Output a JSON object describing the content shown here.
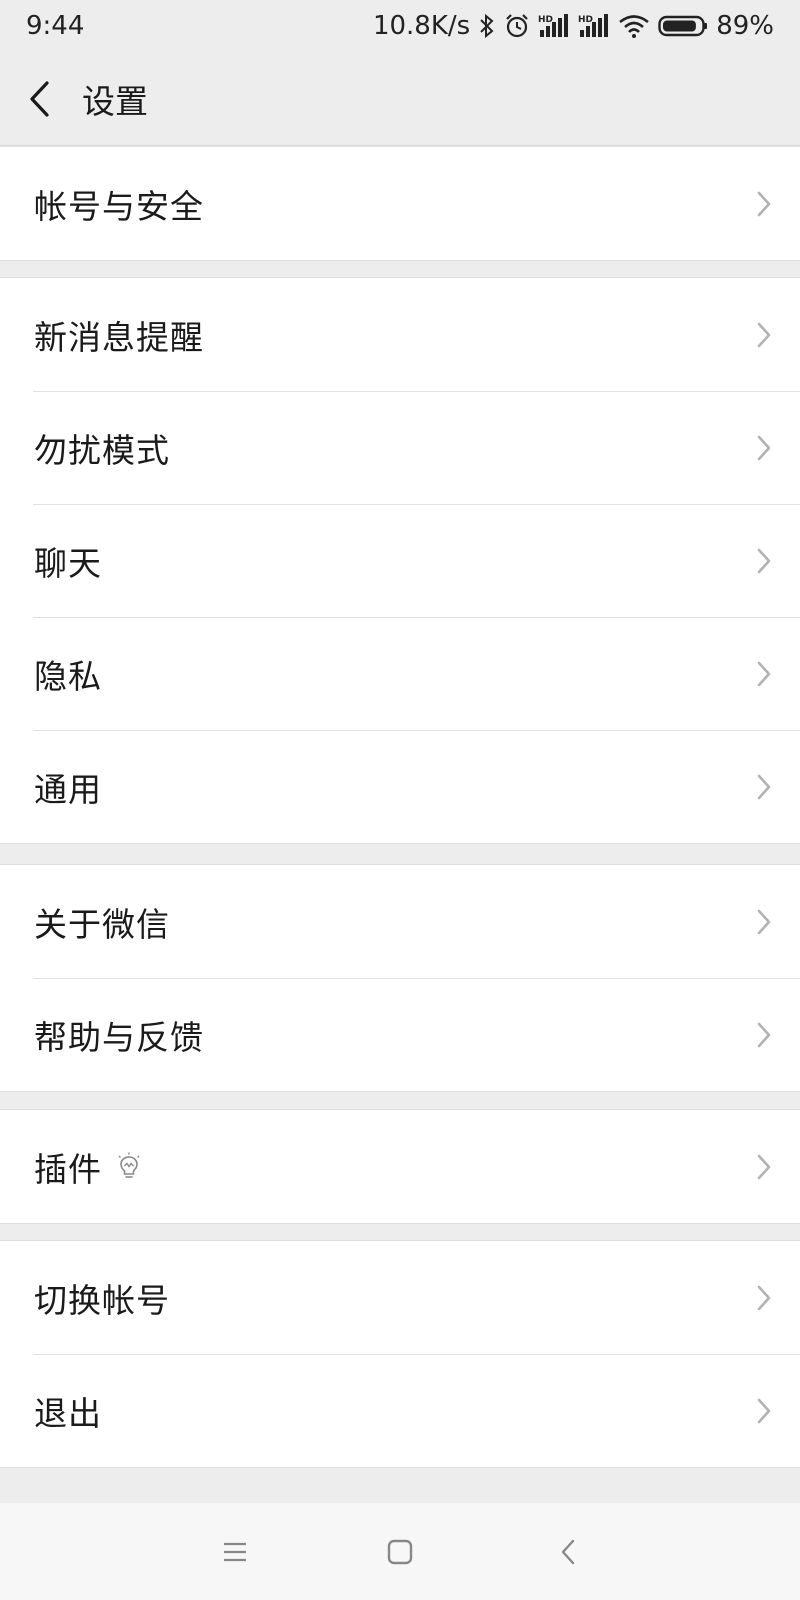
{
  "status_bar": {
    "time": "9:44",
    "net_speed": "10.8K/s",
    "battery_percent": "89%",
    "icons": [
      "bluetooth-icon",
      "alarm-icon",
      "hd-signal-icon",
      "hd-signal-icon",
      "wifi-icon",
      "battery-icon"
    ],
    "battery_level": 0.89
  },
  "header": {
    "back_icon": "chevron-left-icon",
    "title": "设置"
  },
  "groups": [
    {
      "items": [
        {
          "label": "帐号与安全"
        }
      ]
    },
    {
      "items": [
        {
          "label": "新消息提醒"
        },
        {
          "label": "勿扰模式"
        },
        {
          "label": "聊天"
        },
        {
          "label": "隐私"
        },
        {
          "label": "通用"
        }
      ]
    },
    {
      "items": [
        {
          "label": "关于微信"
        },
        {
          "label": "帮助与反馈"
        }
      ]
    },
    {
      "items": [
        {
          "label": "插件",
          "extra_icon": "lightbulb-icon"
        }
      ]
    },
    {
      "items": [
        {
          "label": "切换帐号"
        },
        {
          "label": "退出"
        }
      ]
    }
  ],
  "nav_bar": {
    "icons": [
      "menu-icon",
      "home-icon",
      "back-icon"
    ]
  },
  "colors": {
    "background": "#ededed",
    "row_background": "#ffffff",
    "chevron": "#b2b2b2",
    "text": "#1a1a1a"
  }
}
